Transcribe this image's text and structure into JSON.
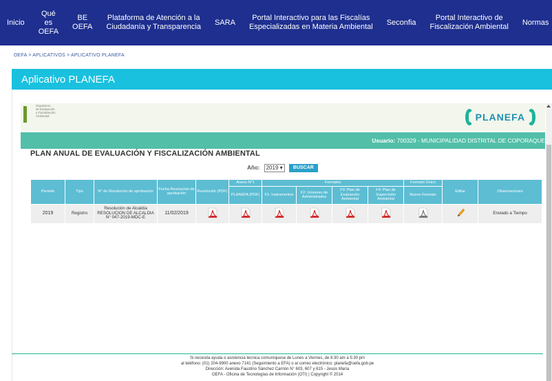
{
  "nav": {
    "items": [
      {
        "lines": [
          "Inicio"
        ]
      },
      {
        "lines": [
          "Qué",
          "es",
          "OEFA"
        ]
      },
      {
        "lines": [
          "BE",
          "OEFA"
        ]
      },
      {
        "lines": [
          "Plataforma de Atención a la",
          "Ciudadanía y Transparencia"
        ]
      },
      {
        "lines": [
          "SARA"
        ]
      },
      {
        "lines": [
          "Portal Interactivo para las Fiscalías",
          "Especializadas en Materia Ambiental"
        ]
      },
      {
        "lines": [
          "Seconfia"
        ]
      },
      {
        "lines": [
          "Portal Interactivo de",
          "Fiscalización Ambiental"
        ]
      },
      {
        "lines": [
          "Normas"
        ]
      }
    ]
  },
  "breadcrumb": "OEFA > APLICATIVOS > APLICATIVO PLANEFA",
  "app_title": "Aplicativo PLANEFA",
  "org": {
    "lines": [
      "Organismo",
      "de Evaluación",
      "y Fiscalización",
      "Ambiental"
    ]
  },
  "logo": {
    "text": "PLANEFA"
  },
  "user": {
    "label": "Usuario:",
    "value": "700329 - MUNICIPALIDAD DISTRITAL DE COPORAQUE"
  },
  "section_title": "PLAN ANUAL DE EVALUACIÓN Y FISCALIZACIÓN AMBIENTAL",
  "year": {
    "label": "Año:",
    "selected": "2019",
    "search_label": "BUSCAR"
  },
  "table": {
    "group_headers": {
      "anexo": "Anexo N°1",
      "formatos": "Formatos",
      "formato_unico": "Formato Único"
    },
    "headers": {
      "periodo": "Periodo",
      "tipo": "Tipo",
      "resolucion_num": "N° de Resolución de aprobación",
      "fecha": "Fecha Resolución de aprobación",
      "resolucion_pdf": "Resolución (PDF)",
      "planefa_pdf": "PLANEFA (PDF)",
      "f1": "F1: Instrumentos",
      "f2": "F2: Universo de Administrados",
      "f3": "F3: Plan de Evaluación Ambiental",
      "f4": "F4: Plan de Supervisión Ambiental",
      "nuevo_formato": "Nuevo Formato",
      "editar": "Editar",
      "observaciones": "Observaciones"
    },
    "rows": [
      {
        "periodo": "2019",
        "tipo": "Registro",
        "resolucion_num": "Resolución de Alcaldía RESOLUCION DE ALCALDIA N° 047-2019-MDC-E",
        "fecha": "11/02/2019",
        "observaciones": "Enviado a Tiempo"
      }
    ]
  },
  "footer": {
    "lines": [
      "Si necesita ayuda o asistencia técnica comuníquese de Lunes a Viernes, de 8:30 am a 5:30 pm",
      "al teléfono: (01) 204-9900 anexo 7141 (Seguimiento a EFA) o al correo electrónico: planefa@oefa.gob.pe",
      "Dirección: Avenida Faustino Sánchez Carrión N° 603, 607 y 615 - Jesús María",
      "OEFA - Oficina de Tecnologías de Información (OTI) | Copyright © 2014"
    ]
  },
  "colors": {
    "nav": "#1e2f8f",
    "title_bar": "#19c1df",
    "user_bar": "#52bfa9",
    "table_header": "#5dbdd3",
    "pdf_red": "#d42a2a"
  }
}
